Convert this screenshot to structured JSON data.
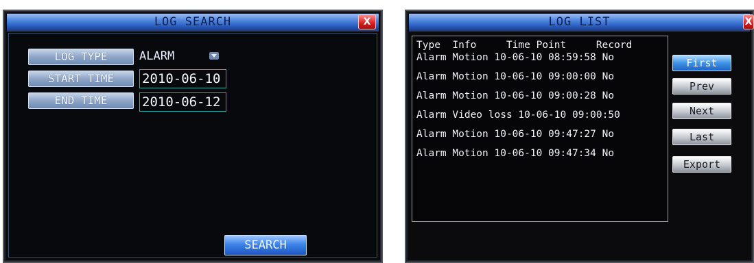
{
  "search": {
    "title": "LOG SEARCH",
    "close": "X",
    "log_type_label": "LOG TYPE",
    "log_type_value": "ALARM",
    "start_time_label": "START TIME",
    "start_time_value": "2010-06-10",
    "end_time_label": "END TIME",
    "end_time_value": "2010-06-12",
    "search_button": "SEARCH"
  },
  "list": {
    "title": "LOG LIST",
    "close": "X",
    "header": "Type  Info     Time Point     Record",
    "rows": [
      "Alarm Motion 10-06-10 08:59:58 No",
      "Alarm Motion 10-06-10 09:00:00 No",
      "Alarm Motion 10-06-10 09:00:28 No",
      "Alarm Video loss 10-06-10 09:00:50",
      "Alarm Motion 10-06-10 09:47:27 No",
      "Alarm Motion 10-06-10 09:47:34 No"
    ],
    "buttons": {
      "first": "First",
      "prev": "Prev",
      "next": "Next",
      "last": "Last",
      "export": "Export"
    }
  },
  "colors": {
    "title_bar": "#3a74d4",
    "label_button": "#8ea6c8",
    "active_button": "#3f93e8",
    "close_button": "#d6201e",
    "field_border": "#2fb3a8"
  }
}
